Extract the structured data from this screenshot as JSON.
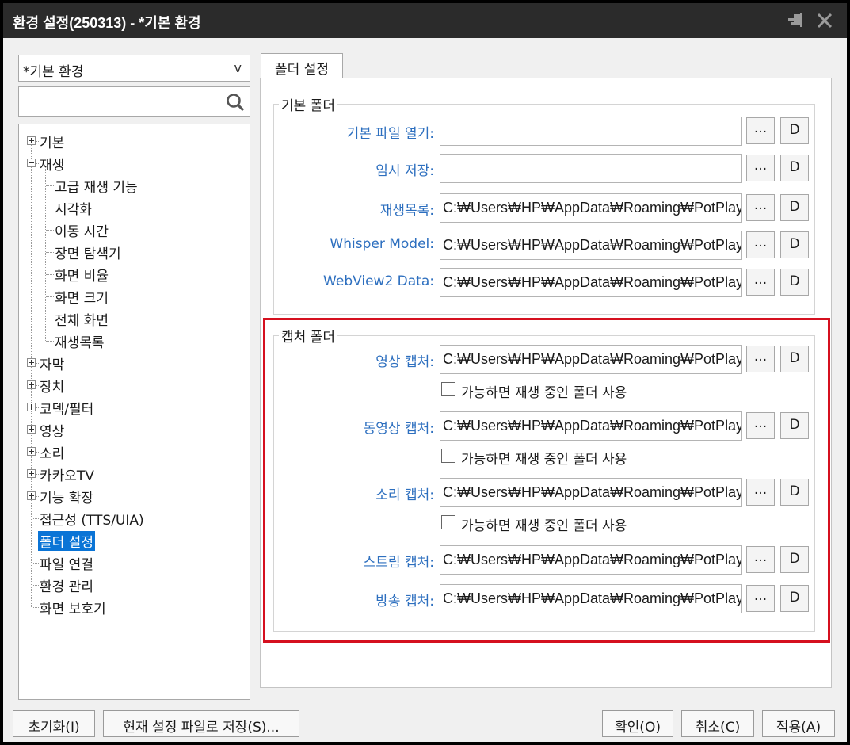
{
  "window": {
    "title": "환경 설정(250313) - *기본 환경"
  },
  "preset": {
    "selected": "*기본 환경"
  },
  "search": {
    "value": "",
    "placeholder": ""
  },
  "tree": {
    "items": [
      {
        "label": "기본",
        "expander": "plus"
      },
      {
        "label": "재생",
        "expander": "minus"
      },
      {
        "label": "고급 재생 기능"
      },
      {
        "label": "시각화"
      },
      {
        "label": "이동 시간"
      },
      {
        "label": "장면 탐색기"
      },
      {
        "label": "화면 비율"
      },
      {
        "label": "화면 크기"
      },
      {
        "label": "전체 화면"
      },
      {
        "label": "재생목록"
      },
      {
        "label": "자막",
        "expander": "plus"
      },
      {
        "label": "장치",
        "expander": "plus"
      },
      {
        "label": "코덱/필터",
        "expander": "plus"
      },
      {
        "label": "영상",
        "expander": "plus"
      },
      {
        "label": "소리",
        "expander": "plus"
      },
      {
        "label": "카카오TV",
        "expander": "plus"
      },
      {
        "label": "기능 확장",
        "expander": "plus"
      },
      {
        "label": "접근성 (TTS/UIA)"
      },
      {
        "label": "폴더 설정",
        "selected": true
      },
      {
        "label": "파일 연결"
      },
      {
        "label": "환경 관리"
      },
      {
        "label": "화면 보호기"
      }
    ]
  },
  "tab": {
    "label": "폴더 설정"
  },
  "basic_folder": {
    "title": "기본 폴더",
    "rows": [
      {
        "label": "기본 파일 열기:",
        "value": ""
      },
      {
        "label": "임시 저장:",
        "value": ""
      },
      {
        "label": "재생목록:",
        "value": "C:₩Users₩HP₩AppData₩Roaming₩PotPlayer₩"
      },
      {
        "label": "Whisper Model:",
        "value": "C:₩Users₩HP₩AppData₩Roaming₩PotPlayer₩"
      },
      {
        "label": "WebView2 Data:",
        "value": "C:₩Users₩HP₩AppData₩Roaming₩PotPlayer₩"
      }
    ]
  },
  "capture_folder": {
    "title": "캡처 폴더",
    "rows": [
      {
        "label": "영상 캡처:",
        "value": "C:₩Users₩HP₩AppData₩Roaming₩PotPlayer₩",
        "checkbox": "가능하면 재생 중인 폴더 사용",
        "checked": false
      },
      {
        "label": "동영상 캡처:",
        "value": "C:₩Users₩HP₩AppData₩Roaming₩PotPlayer₩",
        "checkbox": "가능하면 재생 중인 폴더 사용",
        "checked": false
      },
      {
        "label": "소리 캡처:",
        "value": "C:₩Users₩HP₩AppData₩Roaming₩PotPlayer₩",
        "checkbox": "가능하면 재생 중인 폴더 사용",
        "checked": false
      },
      {
        "label": "스트림 캡처:",
        "value": "C:₩Users₩HP₩AppData₩Roaming₩PotPlayer₩"
      },
      {
        "label": "방송 캡처:",
        "value": "C:₩Users₩HP₩AppData₩Roaming₩PotPlayer₩"
      }
    ]
  },
  "row_buttons": {
    "browse": "...",
    "default": "D"
  },
  "footer": {
    "reset": "초기화(I)",
    "save_file": "현재 설정 파일로 저장(S)...",
    "ok": "확인(O)",
    "cancel": "취소(C)",
    "apply": "적용(A)"
  },
  "colors": {
    "title_bg": "#2b2b2b",
    "label_blue": "#2d6fbf",
    "selection": "#0a74d6",
    "highlight_red": "#d5101f"
  }
}
